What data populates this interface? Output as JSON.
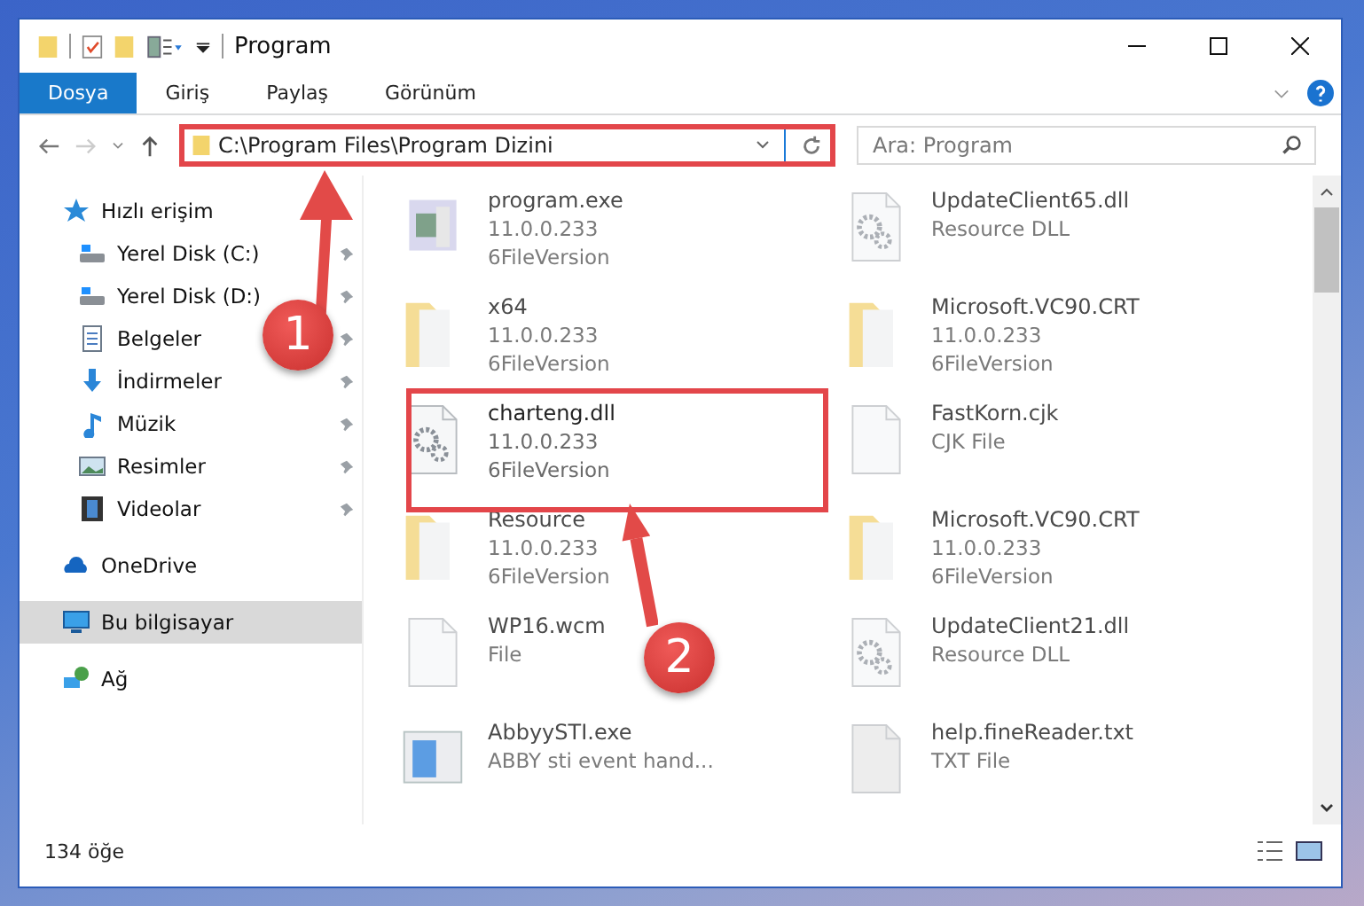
{
  "window": {
    "title": "Program"
  },
  "ribbon_tabs": [
    {
      "label": "Dosya",
      "selected": true
    },
    {
      "label": "Giriş",
      "selected": false
    },
    {
      "label": "Paylaş",
      "selected": false
    },
    {
      "label": "Görünüm",
      "selected": false
    }
  ],
  "address_bar": {
    "path": "C:\\Program Files\\Program Dizini"
  },
  "search": {
    "placeholder": "Ara: Program"
  },
  "sidebar": {
    "items": [
      {
        "label": "Hızlı erişim",
        "kind": "star",
        "selected": false,
        "children": [
          {
            "label": "Yerel Disk (C:)",
            "kind": "drive",
            "pinned": true,
            "selected": false
          },
          {
            "label": "Yerel Disk (D:)",
            "kind": "drive",
            "pinned": true,
            "selected": false
          },
          {
            "label": "Belgeler",
            "kind": "doc",
            "pinned": true,
            "selected": false
          },
          {
            "label": "İndirmeler",
            "kind": "download",
            "pinned": true,
            "selected": false
          },
          {
            "label": "Müzik",
            "kind": "music",
            "pinned": true,
            "selected": false
          },
          {
            "label": "Resimler",
            "kind": "image",
            "pinned": true,
            "selected": false
          },
          {
            "label": "Videolar",
            "kind": "video",
            "pinned": true,
            "selected": false
          }
        ]
      },
      {
        "label": "OneDrive",
        "kind": "cloud",
        "selected": false
      },
      {
        "label": "Bu bilgisayar",
        "kind": "pc",
        "selected": true
      },
      {
        "label": "Ağ",
        "kind": "network",
        "selected": false
      }
    ]
  },
  "files": [
    {
      "name": "program.exe",
      "details": [
        "11.0.0.233",
        "6FileVersion"
      ],
      "kind": "app",
      "blurred": true
    },
    {
      "name": "UpdateClient65.dll",
      "details": [
        "Resource DLL"
      ],
      "kind": "gears",
      "blurred": true
    },
    {
      "name": "x64",
      "details": [
        "11.0.0.233",
        "6FileVersion"
      ],
      "kind": "folder",
      "blurred": true
    },
    {
      "name": "Microsoft.VC90.CRT",
      "details": [
        "11.0.0.233",
        "6FileVersion"
      ],
      "kind": "folder",
      "blurred": true
    },
    {
      "name": "charteng.dll",
      "details": [
        "11.0.0.233",
        "6FileVersion"
      ],
      "kind": "gears",
      "blurred": false
    },
    {
      "name": "FastKorn.cjk",
      "details": [
        "CJK File"
      ],
      "kind": "blank",
      "blurred": true
    },
    {
      "name": "Resource",
      "details": [
        "11.0.0.233",
        "6FileVersion"
      ],
      "kind": "folder",
      "blurred": true
    },
    {
      "name": "Microsoft.VC90.CRT",
      "details": [
        "11.0.0.233",
        "6FileVersion"
      ],
      "kind": "folder",
      "blurred": true
    },
    {
      "name": "WP16.wcm",
      "details": [
        "File"
      ],
      "kind": "blank",
      "blurred": true
    },
    {
      "name": "UpdateClient21.dll",
      "details": [
        "Resource DLL"
      ],
      "kind": "gears",
      "blurred": true
    },
    {
      "name": "AbbyySTI.exe",
      "details": [
        "ABBY sti event hand..."
      ],
      "kind": "window",
      "blurred": true
    },
    {
      "name": "help.fineReader.txt",
      "details": [
        "TXT File"
      ],
      "kind": "txt",
      "blurred": true
    }
  ],
  "status_bar": {
    "count": "134 öğe"
  },
  "annotations": [
    {
      "badge": "1"
    },
    {
      "badge": "2"
    }
  ]
}
